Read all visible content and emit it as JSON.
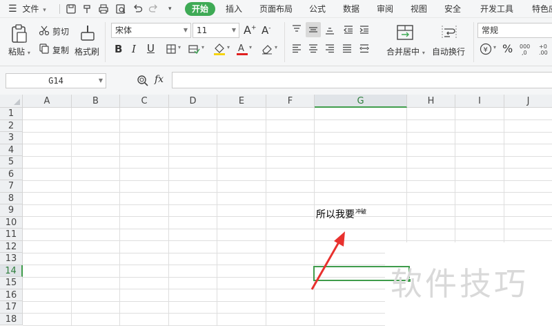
{
  "menubar": {
    "file_label": "文件",
    "tabs": [
      {
        "label": "开始",
        "active": true
      },
      {
        "label": "插入"
      },
      {
        "label": "页面布局"
      },
      {
        "label": "公式"
      },
      {
        "label": "数据"
      },
      {
        "label": "审阅"
      },
      {
        "label": "视图"
      },
      {
        "label": "安全"
      },
      {
        "label": "开发工具"
      },
      {
        "label": "特色应"
      }
    ],
    "quick_icons": [
      "save-icon",
      "format-painter-icon",
      "print-icon",
      "print-preview-icon",
      "undo-icon",
      "redo-icon",
      "more-icon"
    ]
  },
  "ribbon": {
    "paste_label": "粘贴",
    "cut_label": "剪切",
    "copy_label": "复制",
    "format_painter_label": "格式刷",
    "font_name": "宋体",
    "font_size": "11",
    "merge_center_label": "合并居中",
    "wrap_text_label": "自动换行",
    "number_format": "常规",
    "percent_symbol": "%",
    "accent_color": "#3eaa55"
  },
  "formula_bar": {
    "name_box": "G14",
    "fx_label": "fx",
    "formula": ""
  },
  "sheet": {
    "columns": [
      "A",
      "B",
      "C",
      "D",
      "E",
      "F",
      "G",
      "H",
      "I",
      "J"
    ],
    "rows": [
      "1",
      "2",
      "3",
      "4",
      "5",
      "6",
      "7",
      "8",
      "9",
      "10",
      "11",
      "12",
      "13",
      "14",
      "15",
      "16",
      "17",
      "18"
    ],
    "selected_cell": "G14",
    "selected_column": "G",
    "selected_row": "14",
    "cell_g9_text": "所以我要",
    "cell_g9_superscript": "冲破"
  },
  "watermark_text": "软件技巧"
}
